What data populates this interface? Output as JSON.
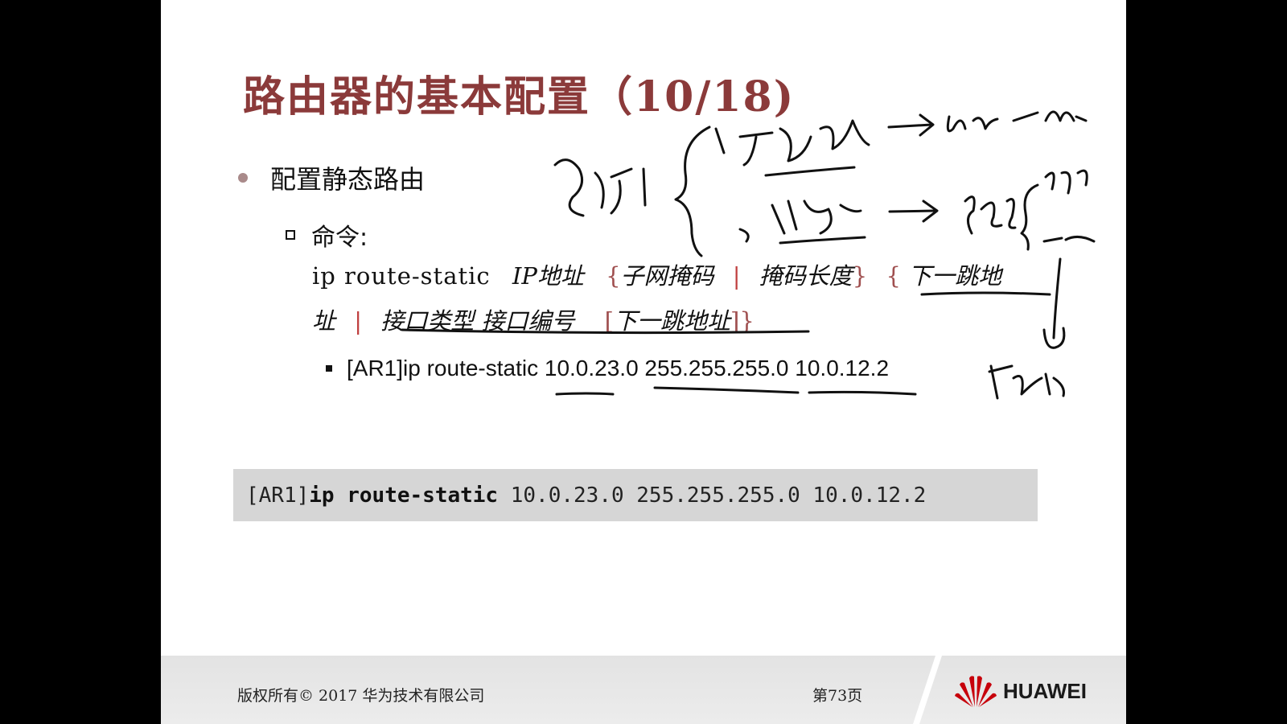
{
  "slide": {
    "title": "路由器的基本配置（10/18)",
    "bullet_l1": "配置静态路由",
    "bullet_l2": "命令:",
    "command": {
      "kw": "ip route-static",
      "p1": "IP地址",
      "b1o": "{",
      "p2": "子网掩码",
      "sep1": "|",
      "p3": "掩码长度",
      "b1c": "}",
      "b2o": "{",
      "p4": "下一跳地",
      "p4b": "址",
      "sep2": "|",
      "p5": "接口类型 接口编号",
      "b3o": "[",
      "p6": "下一跳地址",
      "b3c": "]}"
    },
    "example": "[AR1]ip route-static 10.0.23.0 255.255.255.0 10.0.12.2",
    "code_box": {
      "prompt": "[AR1]",
      "cmd": "ip route-static",
      "args": " 10.0.23.0 255.255.255.0 10.0.12.2"
    }
  },
  "footer": {
    "copyright": "版权所有© 2017 华为技术有限公司",
    "page": "第73页",
    "brand": "HUAWEI"
  },
  "colors": {
    "title": "#8b3a3a",
    "code_bg": "#d6d6d6",
    "logo_red": "#c7000b"
  }
}
